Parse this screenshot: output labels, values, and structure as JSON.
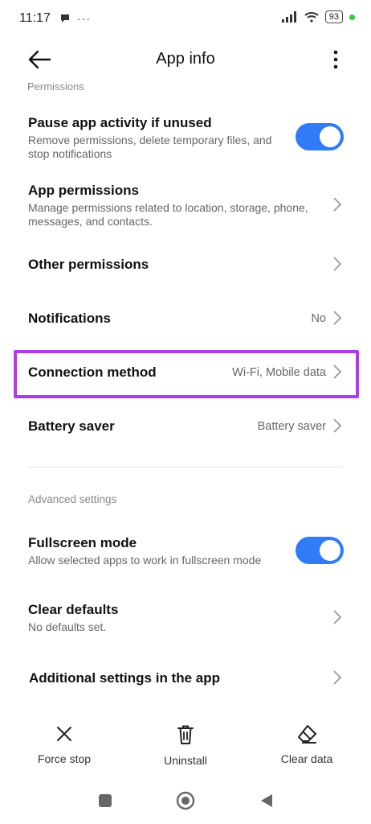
{
  "status": {
    "time": "11:17",
    "battery": "93"
  },
  "appbar": {
    "title": "App info"
  },
  "section_clipped": "Permissions",
  "rows": {
    "pause": {
      "title": "Pause app activity if unused",
      "sub": "Remove permissions, delete temporary files, and stop notifications",
      "enabled": true
    },
    "app_permissions": {
      "title": "App permissions",
      "sub": "Manage permissions related to location, storage, phone, messages, and contacts."
    },
    "other_permissions": {
      "title": "Other permissions"
    },
    "notifications": {
      "title": "Notifications",
      "value": "No"
    },
    "connection": {
      "title": "Connection method",
      "value": "Wi-Fi, Mobile data"
    },
    "battery_saver": {
      "title": "Battery saver",
      "value": "Battery saver"
    },
    "fullscreen": {
      "title": "Fullscreen mode",
      "sub": "Allow selected apps to work in fullscreen mode",
      "enabled": true
    },
    "clear_defaults": {
      "title": "Clear defaults",
      "sub": "No defaults set."
    },
    "additional": {
      "title": "Additional settings in the app"
    }
  },
  "advanced_label": "Advanced settings",
  "actions": {
    "force_stop": "Force stop",
    "uninstall": "Uninstall",
    "clear_data": "Clear data"
  },
  "colors": {
    "accent": "#2f7cf6",
    "highlight": "#a93fe6"
  }
}
